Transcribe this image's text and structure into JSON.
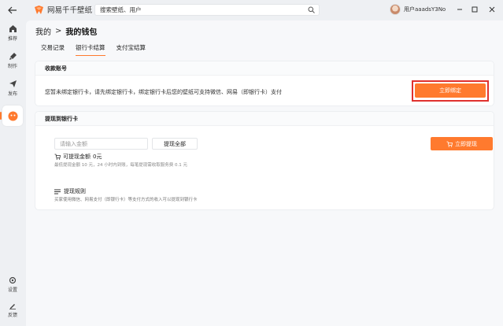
{
  "app": {
    "name": "网易千千壁纸",
    "search_placeholder": "搜索壁纸、用户",
    "username": "用户aaadsY3No",
    "accent": "#ff7a2e",
    "highlight": "#e0312e"
  },
  "sidebar": {
    "items": [
      {
        "label": "推荐",
        "icon": "home-icon"
      },
      {
        "label": "制作",
        "icon": "brush-icon"
      },
      {
        "label": "发布",
        "icon": "send-icon"
      },
      {
        "label": "",
        "icon": "wallet-icon"
      }
    ],
    "bottom": [
      {
        "label": "设置",
        "icon": "gear-icon"
      },
      {
        "label": "反馈",
        "icon": "pen-icon"
      }
    ]
  },
  "breadcrumb": {
    "parent": "我的",
    "separator": ">",
    "current": "我的钱包"
  },
  "tabs": [
    "交易记录",
    "银行卡结算",
    "支付宝结算"
  ],
  "account_card": {
    "title": "收款账号",
    "description": "您暂未绑定银行卡，请先绑定银行卡，绑定银行卡后您的壁纸可支持微信、网易（即银行卡）支付",
    "bind_button": "立即绑定"
  },
  "withdraw_card": {
    "title": "提现到银行卡",
    "amount_placeholder": "请输入金额",
    "all_button": "提现全部",
    "available_label": "可提现金额",
    "available_value": "0元",
    "note": "最低提现金额 10 元，24 小时内到账，每笔提现需收取服务费 0.1 元",
    "withdraw_button": "立即提现",
    "rules_title": "提现规则",
    "rules_desc": "买家使用微信、网易支付（即银行卡）等支付方式的收入可以提现到银行卡"
  }
}
